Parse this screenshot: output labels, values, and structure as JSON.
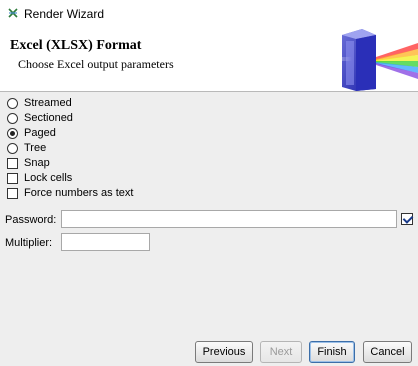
{
  "window": {
    "title": "Render Wizard"
  },
  "header": {
    "title": "Excel (XLSX) Format",
    "subtitle": "Choose Excel output parameters"
  },
  "layout_options": [
    {
      "label": "Streamed",
      "type": "radio",
      "selected": false
    },
    {
      "label": "Sectioned",
      "type": "radio",
      "selected": false
    },
    {
      "label": "Paged",
      "type": "radio",
      "selected": true
    },
    {
      "label": "Tree",
      "type": "radio",
      "selected": false
    }
  ],
  "checkbox_options": [
    {
      "label": "Snap",
      "checked": false
    },
    {
      "label": "Lock cells",
      "checked": false
    },
    {
      "label": "Force numbers as text",
      "checked": false
    }
  ],
  "password": {
    "label": "Password:",
    "value": "",
    "enabled_checked": true
  },
  "multiplier": {
    "label": "Multiplier:",
    "value": ""
  },
  "buttons": {
    "previous": "Previous",
    "next": "Next",
    "finish": "Finish",
    "cancel": "Cancel"
  },
  "colors": {
    "panel_bg": "#eeeeee",
    "header_bg": "#ffffff",
    "accent": "#3c6ea8"
  }
}
